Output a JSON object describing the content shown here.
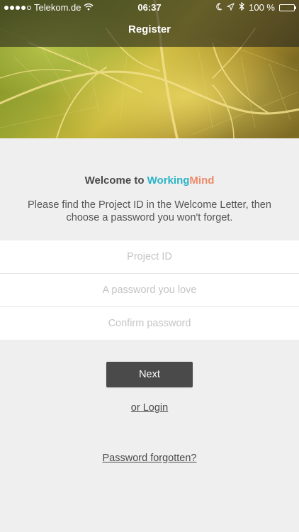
{
  "status_bar": {
    "carrier": "Telekom.de",
    "time": "06:37",
    "battery_text": "100 %",
    "signal_bars_filled": 4,
    "signal_bars_total": 5,
    "icons": [
      "wifi-icon",
      "moon-icon",
      "location-arrow-icon",
      "bluetooth-icon",
      "battery-icon"
    ]
  },
  "nav": {
    "title": "Register"
  },
  "welcome": {
    "prefix": "Welcome to ",
    "brand_part1": "Working",
    "brand_part2": "Mind"
  },
  "instructions": "Please find the Project ID in the Welcome Letter, then choose a password you won't forget.",
  "form": {
    "project_id": {
      "value": "",
      "placeholder": "Project ID"
    },
    "password": {
      "value": "",
      "placeholder": "A password you love"
    },
    "confirm_password": {
      "value": "",
      "placeholder": "Confirm password"
    }
  },
  "actions": {
    "next_label": "Next",
    "login_label": "or Login",
    "forgot_label": "Password forgotten?"
  },
  "colors": {
    "background": "#efefef",
    "brand_working": "#2bb3c6",
    "brand_mind": "#ee8a68",
    "button_bg": "#4a4a4a"
  }
}
